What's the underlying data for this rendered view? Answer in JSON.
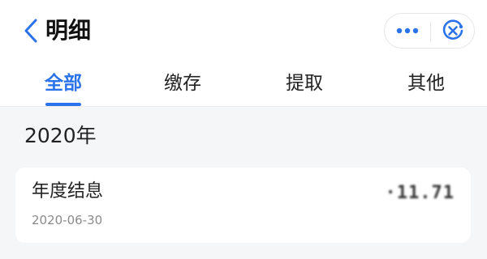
{
  "header": {
    "title": "明细",
    "back_icon": "chevron-left-icon",
    "more_icon": "more-dots-icon",
    "close_icon": "close-circle-icon"
  },
  "tabs": [
    {
      "label": "全部",
      "active": true
    },
    {
      "label": "缴存",
      "active": false
    },
    {
      "label": "提取",
      "active": false
    },
    {
      "label": "其他",
      "active": false
    }
  ],
  "sections": [
    {
      "year": "2020年",
      "records": [
        {
          "title": "年度结息",
          "date": "2020-06-30",
          "amount": "·11.71"
        }
      ]
    }
  ],
  "colors": {
    "accent": "#2b73ea",
    "background": "#f5f6f8",
    "card": "#ffffff"
  }
}
